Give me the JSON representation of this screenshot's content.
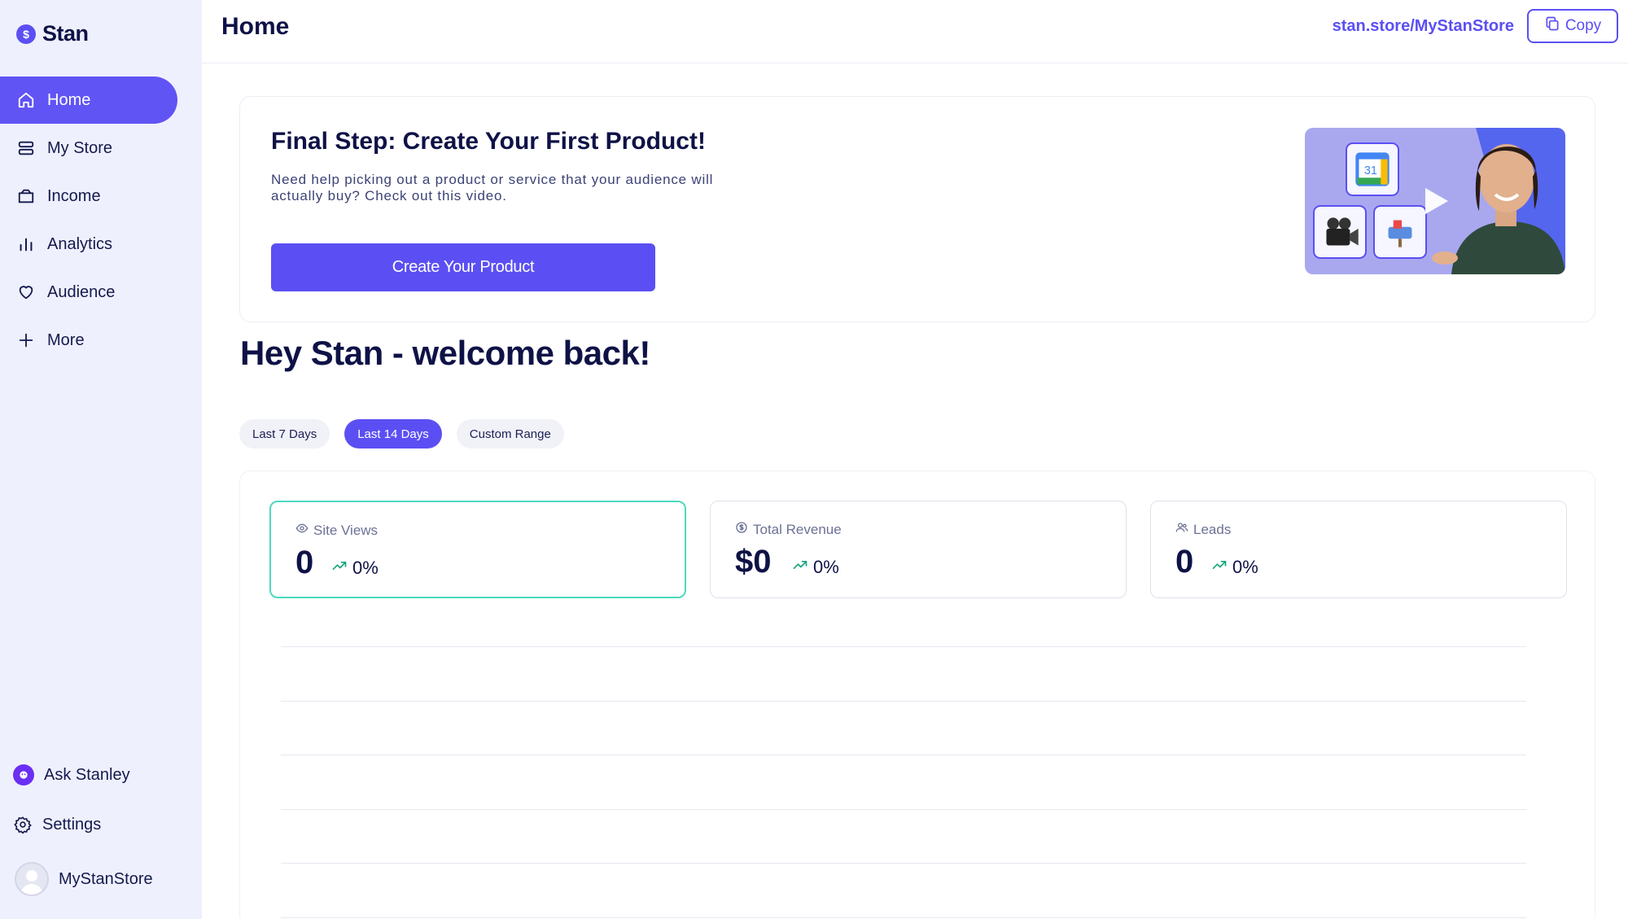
{
  "brand": {
    "name": "Stan",
    "icon": "dollar-coin-icon"
  },
  "sidebar": {
    "items": [
      {
        "label": "Home",
        "icon": "home-icon",
        "active": true
      },
      {
        "label": "My Store",
        "icon": "store-icon",
        "active": false
      },
      {
        "label": "Income",
        "icon": "wallet-icon",
        "active": false
      },
      {
        "label": "Analytics",
        "icon": "bar-chart-icon",
        "active": false
      },
      {
        "label": "Audience",
        "icon": "heart-icon",
        "active": false
      },
      {
        "label": "More",
        "icon": "plus-icon",
        "active": false
      }
    ],
    "bottom": {
      "ask": "Ask Stanley",
      "settings": "Settings",
      "account": "MyStanStore"
    }
  },
  "header": {
    "title": "Home",
    "store_link": "stan.store/MyStanStore",
    "copy_label": "Copy"
  },
  "onboarding": {
    "title": "Final Step: Create Your First Product!",
    "description": "Need help picking out a product or service that your audience will actually buy? Check out this video.",
    "button_label": "Create Your Product",
    "calendar_day": "31"
  },
  "welcome": "Hey Stan - welcome back!",
  "date_ranges": [
    {
      "label": "Last 7 Days",
      "active": false
    },
    {
      "label": "Last 14 Days",
      "active": true
    },
    {
      "label": "Custom Range",
      "active": false
    }
  ],
  "stats": [
    {
      "label": "Site Views",
      "icon": "eye-icon",
      "value": "0",
      "change": "0%",
      "selected": true
    },
    {
      "label": "Total Revenue",
      "icon": "dollar-circle-icon",
      "value": "$0",
      "change": "0%",
      "selected": false
    },
    {
      "label": "Leads",
      "icon": "users-icon",
      "value": "0",
      "change": "0%",
      "selected": false
    }
  ],
  "colors": {
    "accent": "#5b4ff3",
    "sidebar_bg": "#eff0fd",
    "selected_card_border": "#4fd9bf",
    "trend_up": "#16a37a"
  }
}
